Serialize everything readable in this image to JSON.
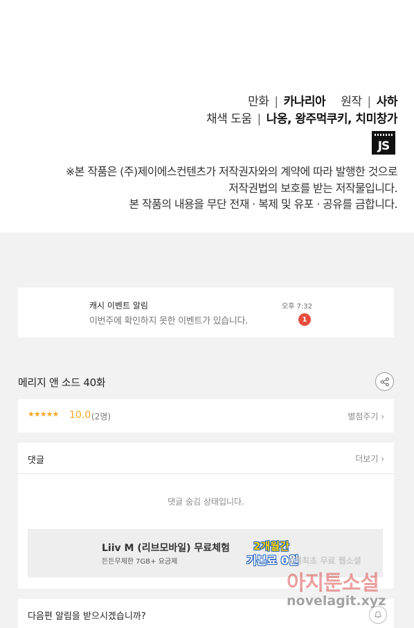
{
  "credits": {
    "comic_label": "만화",
    "comic_author": "카나리아",
    "original_label": "원작",
    "original_author": "사하",
    "color_label": "채색 도움",
    "color_assistants": "나옹, 왕주먹쿠키, 치미창가",
    "logo_text": "JS",
    "notice_lines": [
      "※본 작품은 (주)제이에스컨텐츠가 저작권자와의 계약에 따라 발행한 것으로",
      "저작권법의 보호를 받는 저작물입니다.",
      "본 작품의 내용을 무단 전재 · 복제 및 유포 · 공유를 금합니다."
    ]
  },
  "event": {
    "title": "캐시 이벤트 알림",
    "message": "이번주에 확인하지 못한 이벤트가 있습니다.",
    "time": "오후 7:32",
    "badge_count": "1"
  },
  "episode": {
    "title": "메리지 앤 소드 40화",
    "share_icon": "share-icon"
  },
  "rating": {
    "stars": "★★★★★",
    "score": "10.0",
    "count": "(2명)",
    "rate_link": "별점주기 ›"
  },
  "comments": {
    "label": "댓글",
    "more_link": "더보기 ›",
    "hidden_message": "댓글 숨김 상태입니다."
  },
  "ad": {
    "title": "Liiv M (리브모바일) 무료체험",
    "subtitle": "든든무제한 7GB+ 요금제",
    "badge_line1": "2개월간",
    "badge_line2": "기본료 0원"
  },
  "notify": {
    "label": "다음편 알림을 받으시겠습니까?"
  },
  "watermark": {
    "line1": "세계최초 무료 웹소설",
    "line2": "아지툰소설",
    "line3": "novelagit.xyz"
  },
  "colors": {
    "accent_star": "#f5a623",
    "badge_red": "#e74c3c"
  }
}
